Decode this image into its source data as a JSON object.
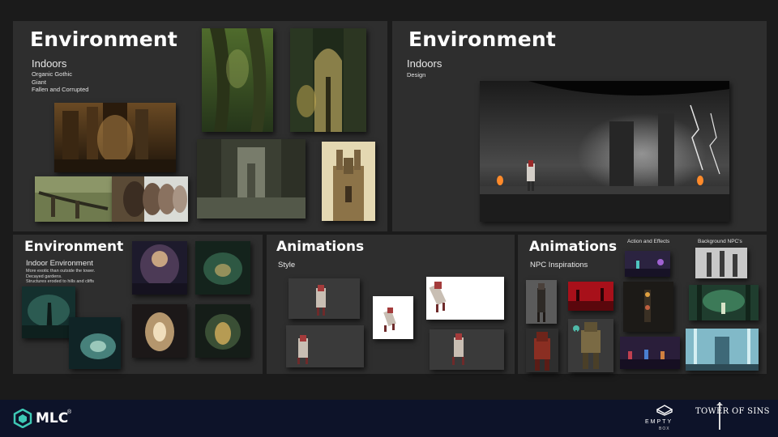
{
  "panel_tl": {
    "title": "Environment",
    "subtitle": "Indoors",
    "lines": [
      "Organic Gothic",
      "Giant",
      "Fallen and Corrupted"
    ]
  },
  "panel_tr": {
    "title": "Environment",
    "subtitle": "Indoors",
    "caption": "Design"
  },
  "panel_bl": {
    "title": "Environment",
    "subtitle": "Indoor Environment",
    "notes": [
      "More exotic than outside the tower.",
      "Decayed gardens.",
      "Structures eroded to hills and cliffs"
    ]
  },
  "panel_bm": {
    "title": "Animations",
    "subtitle": "Style"
  },
  "panel_br": {
    "title": "Animations",
    "subtitle": "NPC Inspirations",
    "label_a": "Action and Effects",
    "label_b": "Background NPC's"
  },
  "footer": {
    "brand": "MLC",
    "reg": "®",
    "empty_title": "EMPTY",
    "empty_sub": "BOX",
    "tower": "TOWER OF SINS"
  },
  "icons": [
    "mlc-logo-icon",
    "empty-box-logo-icon",
    "tower-of-sins-logo-icon"
  ],
  "colors": {
    "background": "#1b1b1b",
    "panel": "#2e2e2e",
    "footer": "#0d1329",
    "mlc_teal": "#3ec9b5"
  }
}
